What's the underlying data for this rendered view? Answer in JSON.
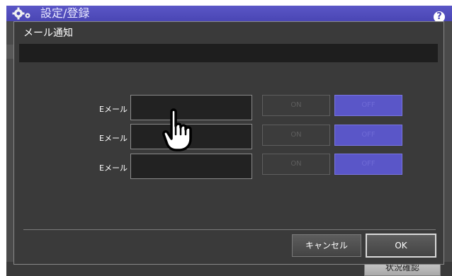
{
  "header": {
    "title": "設定/登録",
    "help_icon": "help-icon",
    "settings_icon": "gear-icon"
  },
  "dialog": {
    "title": "メール通知",
    "rows": [
      {
        "label": "Eメール",
        "value": "",
        "on_label": "ON",
        "off_label": "OFF"
      },
      {
        "label": "Eメール",
        "value": "",
        "on_label": "ON",
        "off_label": "OFF"
      },
      {
        "label": "Eメール",
        "value": "",
        "on_label": "ON",
        "off_label": "OFF"
      }
    ],
    "cancel_label": "キャンセル",
    "ok_label": "OK"
  },
  "footer": {
    "status_label": "状況確認"
  },
  "colors": {
    "header_bg": "#4a46b4",
    "off_button": "#5a56c8",
    "dialog_bg": "#3a3a3a"
  }
}
